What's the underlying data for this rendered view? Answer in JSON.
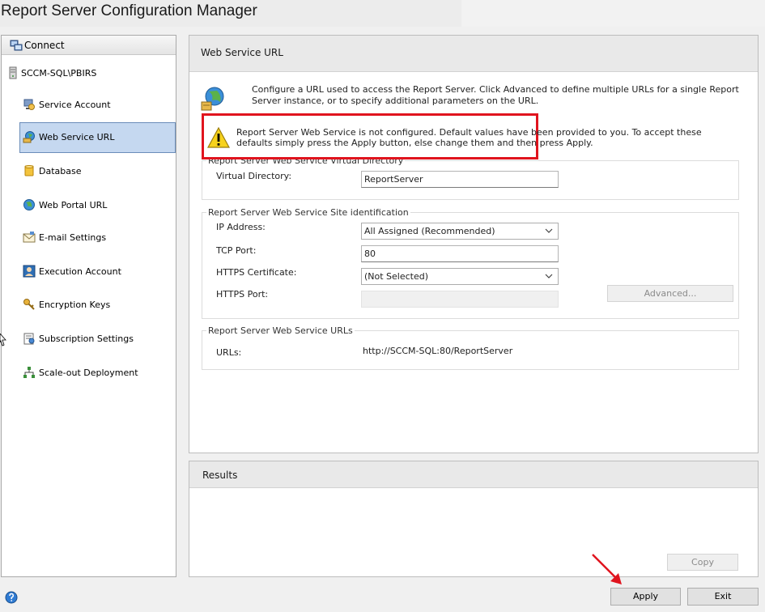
{
  "window": {
    "title": "Report Server Configuration Manager"
  },
  "nav": {
    "connect_label": "Connect",
    "server_name": "SCCM-SQL\\PBIRS",
    "items": [
      {
        "label": "Service Account",
        "icon": "service-account-icon"
      },
      {
        "label": "Web Service URL",
        "icon": "web-service-url-icon",
        "selected": true
      },
      {
        "label": "Database",
        "icon": "database-icon"
      },
      {
        "label": "Web Portal URL",
        "icon": "globe-icon"
      },
      {
        "label": "E-mail Settings",
        "icon": "email-icon"
      },
      {
        "label": "Execution Account",
        "icon": "execution-account-icon"
      },
      {
        "label": "Encryption Keys",
        "icon": "key-icon"
      },
      {
        "label": "Subscription Settings",
        "icon": "subscription-icon"
      },
      {
        "label": "Scale-out Deployment",
        "icon": "scale-out-icon"
      }
    ]
  },
  "main": {
    "title": "Web Service URL",
    "intro": "Configure a URL used to access the Report Server.  Click Advanced to define multiple URLs for a single Report Server instance, or to specify additional parameters on the URL.",
    "warning": "Report Server Web Service is not configured. Default values have been provided to you. To accept these defaults simply press the Apply button, else change them and then press Apply.",
    "virtual_directory_group": {
      "legend": "Report Server Web Service Virtual Directory",
      "label": "Virtual Directory:",
      "value": "ReportServer"
    },
    "site_group": {
      "legend": "Report Server Web Service Site identification",
      "ip_label": "IP Address:",
      "ip_value": "All Assigned (Recommended)",
      "tcp_label": "TCP Port:",
      "tcp_value": "80",
      "https_cert_label": "HTTPS Certificate:",
      "https_cert_value": "(Not Selected)",
      "https_port_label": "HTTPS Port:",
      "https_port_value": "",
      "advanced_label": "Advanced..."
    },
    "urls_group": {
      "legend": "Report Server Web Service URLs",
      "label": "URLs:",
      "value": "http://SCCM-SQL:80/ReportServer"
    }
  },
  "results": {
    "title": "Results",
    "copy_label": "Copy"
  },
  "footer": {
    "apply_label": "Apply",
    "exit_label": "Exit"
  },
  "colors": {
    "highlight_border": "#e0141e",
    "arrow": "#e0141e",
    "selected_bg": "#c5d8f0",
    "selected_border": "#6b8db9"
  }
}
